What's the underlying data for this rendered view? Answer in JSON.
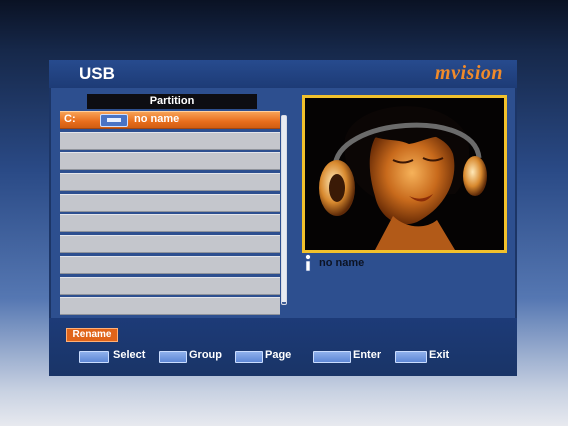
{
  "header": {
    "title": "USB",
    "brand": "mvision"
  },
  "partition": {
    "header": "Partition",
    "rows": [
      {
        "drive": "C:",
        "name": "no name",
        "selected": true
      },
      {
        "drive": "",
        "name": "",
        "selected": false
      },
      {
        "drive": "",
        "name": "",
        "selected": false
      },
      {
        "drive": "",
        "name": "",
        "selected": false
      },
      {
        "drive": "",
        "name": "",
        "selected": false
      },
      {
        "drive": "",
        "name": "",
        "selected": false
      },
      {
        "drive": "",
        "name": "",
        "selected": false
      },
      {
        "drive": "",
        "name": "",
        "selected": false
      },
      {
        "drive": "",
        "name": "",
        "selected": false
      },
      {
        "drive": "",
        "name": "",
        "selected": false
      }
    ]
  },
  "preview": {
    "caption": "no name"
  },
  "footer": {
    "rename_label": "Rename",
    "hints": [
      {
        "key_icon": "up-down-key-icon",
        "label": "Select"
      },
      {
        "key_icon": "left-right-key-icon",
        "label": "Group"
      },
      {
        "key_icon": "page-key-icon",
        "label": "Page"
      },
      {
        "key_icon": "ok-key-icon",
        "label": "Enter"
      },
      {
        "key_icon": "exit-key-icon",
        "label": "Exit"
      }
    ]
  },
  "colors": {
    "selection": "#e86d1c",
    "brand": "#f08a2a",
    "panel": "#2d4f8f",
    "preview_border": "#f2c12c"
  }
}
